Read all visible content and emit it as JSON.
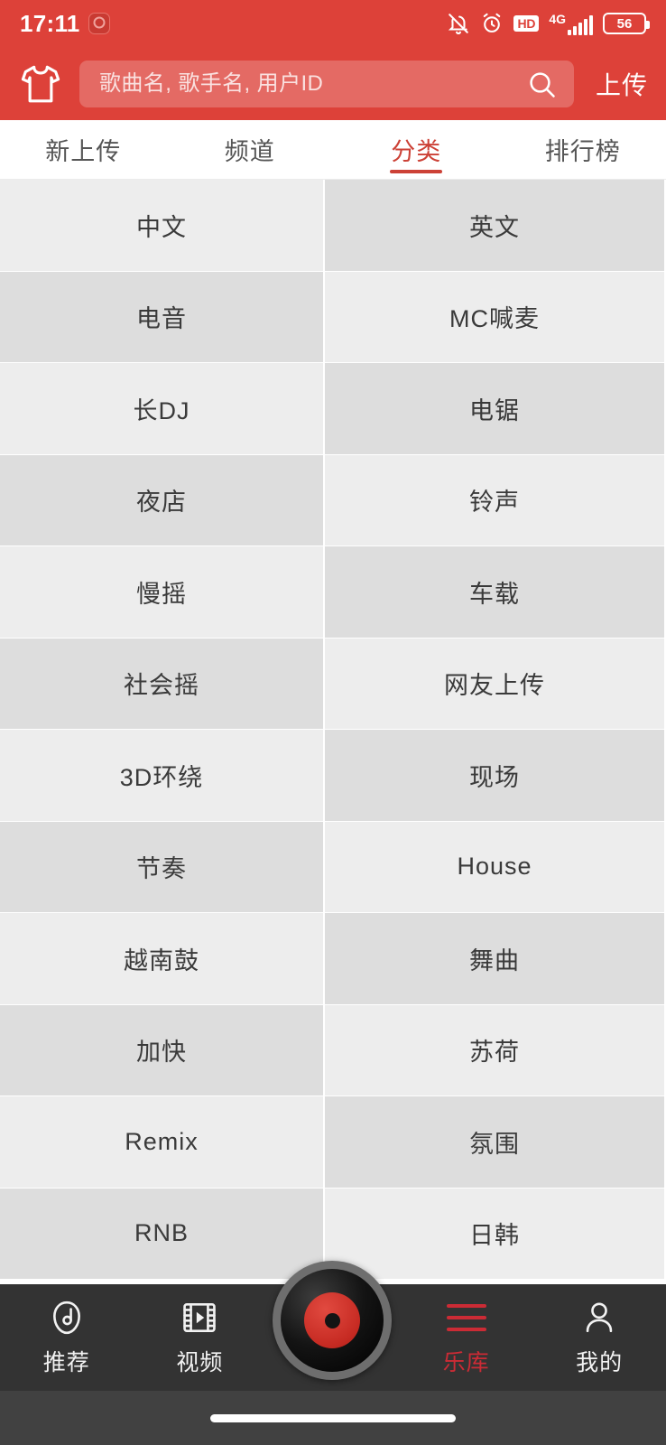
{
  "status_bar": {
    "time": "17:11",
    "app_badge_icon": "app-badge-icon",
    "icons": [
      {
        "name": "bell-muted-icon"
      },
      {
        "name": "alarm-clock-icon"
      },
      {
        "name": "hd-icon",
        "label": "HD"
      },
      {
        "name": "signal-4g-icon",
        "label": "4G"
      },
      {
        "name": "battery-icon",
        "label": "56"
      }
    ],
    "battery_level": "56",
    "network_label": "4G",
    "hd_label": "HD",
    "background_color": "#dd4139"
  },
  "header": {
    "logo_icon": "tshirt-logo-icon",
    "search": {
      "placeholder": "歌曲名, 歌手名, 用户ID",
      "value": "",
      "icon": "search-icon"
    },
    "upload_label": "上传",
    "background_color": "#dd4139"
  },
  "tabs": {
    "active_index": 2,
    "accent_color": "#cc4136",
    "items": [
      {
        "label": "新上传"
      },
      {
        "label": "频道"
      },
      {
        "label": "分类"
      },
      {
        "label": "排行榜"
      }
    ]
  },
  "categories": {
    "colors": {
      "light": "#ededed",
      "dark": "#dddddd"
    },
    "items": [
      {
        "label": "中文"
      },
      {
        "label": "英文"
      },
      {
        "label": "电音"
      },
      {
        "label": "MC喊麦"
      },
      {
        "label": "长DJ"
      },
      {
        "label": "电锯"
      },
      {
        "label": "夜店"
      },
      {
        "label": "铃声"
      },
      {
        "label": "慢摇"
      },
      {
        "label": "车载"
      },
      {
        "label": "社会摇"
      },
      {
        "label": "网友上传"
      },
      {
        "label": "3D环绕"
      },
      {
        "label": "现场"
      },
      {
        "label": "节奏"
      },
      {
        "label": "House"
      },
      {
        "label": "越南鼓"
      },
      {
        "label": "舞曲"
      },
      {
        "label": "加快"
      },
      {
        "label": "苏荷"
      },
      {
        "label": "Remix"
      },
      {
        "label": "氛围"
      },
      {
        "label": "RNB"
      },
      {
        "label": "日韩"
      }
    ]
  },
  "bottom_nav": {
    "active_index": 3,
    "active_color": "#cc2b35",
    "background_color": "#333333",
    "items": [
      {
        "label": "推荐",
        "icon": "music-note-icon"
      },
      {
        "label": "视频",
        "icon": "video-film-icon"
      },
      {
        "label": "乐库",
        "icon": "library-lines-icon"
      },
      {
        "label": "我的",
        "icon": "person-icon"
      }
    ],
    "center_button": {
      "icon": "vinyl-record-icon",
      "label": ""
    }
  }
}
